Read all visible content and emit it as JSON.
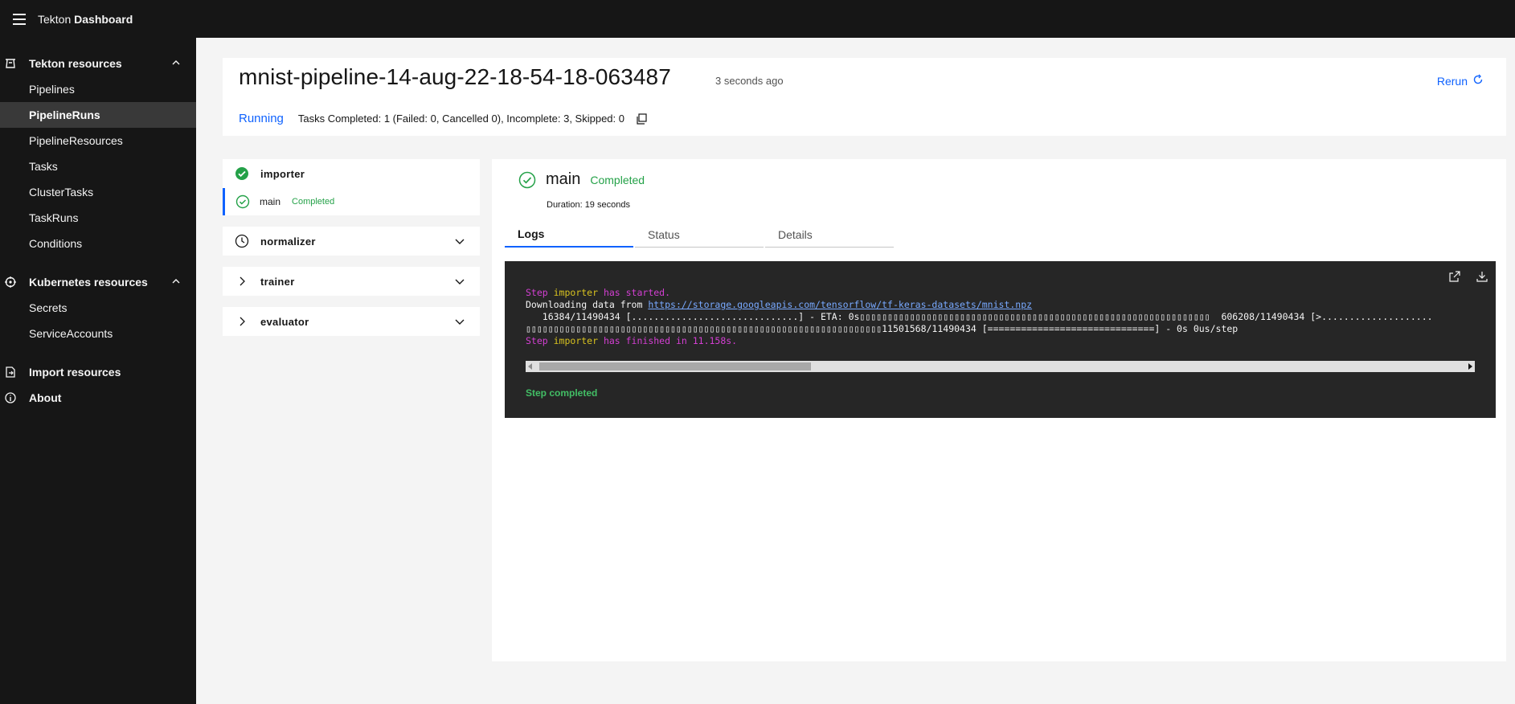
{
  "header": {
    "brand_first": "Tekton",
    "brand_second": "Dashboard"
  },
  "sidebar": {
    "tekton_category": "Tekton resources",
    "tekton_items": [
      "Pipelines",
      "PipelineRuns",
      "PipelineResources",
      "Tasks",
      "ClusterTasks",
      "TaskRuns",
      "Conditions"
    ],
    "active_item": "PipelineRuns",
    "k8s_category": "Kubernetes resources",
    "k8s_items": [
      "Secrets",
      "ServiceAccounts"
    ],
    "import_label": "Import resources",
    "about_label": "About"
  },
  "run": {
    "name": "mnist-pipeline-14-aug-22-18-54-18-063487",
    "time_ago": "3 seconds ago",
    "rerun_label": "Rerun",
    "status": "Running",
    "summary": "Tasks Completed: 1 (Failed: 0, Cancelled 0), Incomplete: 3, Skipped: 0"
  },
  "tasks": {
    "importer": "importer",
    "step_main": "main",
    "step_main_status": "Completed",
    "normalizer": "normalizer",
    "trainer": "trainer",
    "evaluator": "evaluator"
  },
  "step": {
    "name": "main",
    "status": "Completed",
    "duration": "Duration: 19 seconds",
    "tabs": [
      "Logs",
      "Status",
      "Details"
    ],
    "active_tab": "Logs"
  },
  "log": {
    "line1_a": "Step ",
    "line1_b": "importer",
    "line1_c": " has started.",
    "line2_a": "Downloading data from ",
    "line2_link": "https://storage.googleapis.com/tensorflow/tf-keras-datasets/mnist.npz",
    "line3": "   16384/11490434 [..............................] - ETA: 0s▯▯▯▯▯▯▯▯▯▯▯▯▯▯▯▯▯▯▯▯▯▯▯▯▯▯▯▯▯▯▯▯▯▯▯▯▯▯▯▯▯▯▯▯▯▯▯▯▯▯▯▯▯▯▯▯▯▯▯▯▯▯▯  606208/11490434 [>....................",
    "line4": "▯▯▯▯▯▯▯▯▯▯▯▯▯▯▯▯▯▯▯▯▯▯▯▯▯▯▯▯▯▯▯▯▯▯▯▯▯▯▯▯▯▯▯▯▯▯▯▯▯▯▯▯▯▯▯▯▯▯▯▯▯▯▯▯11501568/11490434 [==============================] - 0s 0us/step",
    "line5_a": "Step ",
    "line5_b": "importer",
    "line5_c": " has finished in 11.158s.",
    "step_completed": "Step completed"
  },
  "colors": {
    "accent_blue": "#0f62fe",
    "success_green": "#24a148",
    "log_magenta": "#d43fd3",
    "log_yellow": "#d8c21f",
    "dark_bg": "#161616"
  }
}
